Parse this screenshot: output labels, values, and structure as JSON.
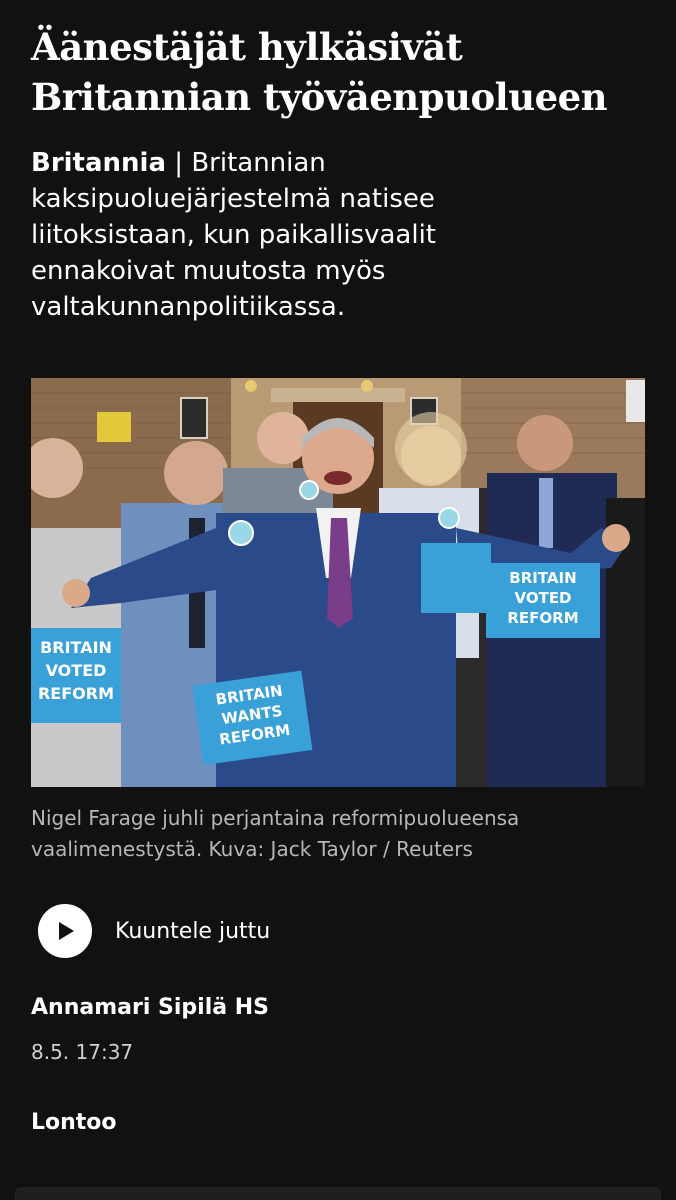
{
  "article": {
    "headline": "Äänestäjät hylkäsivät Britannian työväenpuolueen",
    "section": "Britannia",
    "section_separator": " | ",
    "lead": "Britannian kaksipuoluejärjestelmä natisee liitoksistaan, kun paikallisvaalit ennakoivat muutosta myös valtakunnanpolitiikassa.",
    "photo": {
      "placard_1": [
        "BRITAIN",
        "VOTED",
        "REFORM"
      ],
      "placard_2": [
        "BRITAIN",
        "WANTS",
        "REFORM"
      ],
      "placard_3": [
        "BRITAIN",
        "VOTED",
        "REFORM"
      ]
    },
    "caption": "Nigel Farage juhli perjantaina reformipuolueensa vaalimenestystä. Kuva: Jack Taylor / Reuters",
    "listen_label": "Kuuntele juttu",
    "author": "Annamari Sipilä HS",
    "date": "8.5. 17:37",
    "dateline": "Lontoo"
  },
  "colors": {
    "background": "#111111",
    "text": "#ffffff",
    "caption": "#b7b7b7",
    "placard": "#3aa0d8"
  },
  "icons": {
    "play": "play-icon"
  }
}
